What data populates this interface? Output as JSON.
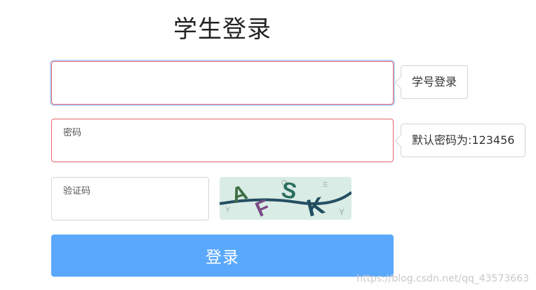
{
  "page": {
    "title": "学生登录"
  },
  "account": {
    "value": "",
    "tip": "学号登录"
  },
  "password": {
    "label": "密码",
    "value": "",
    "tip": "默认密码为:123456"
  },
  "captcha": {
    "label": "验证码",
    "value": "",
    "image_text": "AFSK"
  },
  "login_button": {
    "label": "登录"
  },
  "watermark": "https://blog.csdn.net/qq_43573663",
  "colors": {
    "button": "#5aa8fb",
    "error_border": "#e5646b",
    "focus_ring": "#b9d4f7",
    "captcha_bg": "#d9ece5"
  }
}
